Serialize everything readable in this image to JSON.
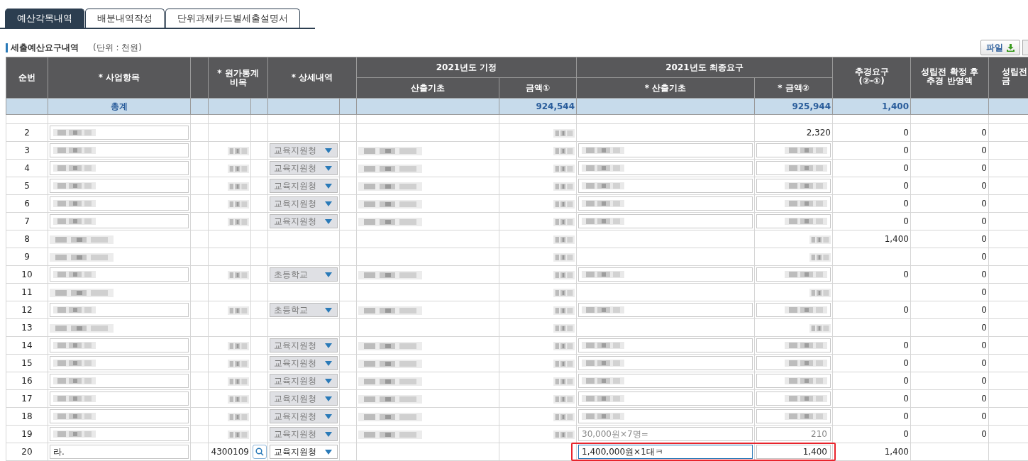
{
  "tabs": [
    {
      "label": "예산각목내역",
      "selected": true
    },
    {
      "label": "배분내역작성",
      "selected": false
    },
    {
      "label": "단위과제카드별세출설명서",
      "selected": false
    }
  ],
  "section": {
    "title": "세출예산요구내역",
    "unit": "(단위 : 천원)",
    "file_button": "파일"
  },
  "table": {
    "header_top": [
      "순번",
      "* 사업항목",
      "* 원가통계\n비목",
      "* 상세내역",
      "2021년도 기정",
      "2021년도 최종요구",
      "추경요구\n(②-①)",
      "성립전 확정 후\n추경 반영액",
      "성립전\n금"
    ],
    "header_sub": [
      "산출기초",
      "금액①",
      "* 산출기초",
      "* 금액②"
    ],
    "total": {
      "label": "총계",
      "plan_amount": "924,544",
      "final_amount": "925,944",
      "supplement": "1,400"
    },
    "rows": [
      {
        "no": "2",
        "item": {
          "field": true,
          "redacted": true
        },
        "plan_amount": {
          "redacted": true
        },
        "final_amount": {
          "text": "2,320"
        },
        "supplement": "0",
        "reflected": "0"
      },
      {
        "no": "3",
        "item": {
          "field": true,
          "redacted": true
        },
        "code": {
          "redacted": true
        },
        "detail": {
          "value": "교육지원청",
          "disabled": true
        },
        "plan_basis": {
          "redacted": true
        },
        "plan_amount": {
          "redacted": true
        },
        "final_basis": {
          "field": true,
          "redacted": true
        },
        "final_amount": {
          "field": true,
          "redacted": true
        },
        "supplement": "0",
        "reflected": "0"
      },
      {
        "no": "4",
        "item": {
          "field": true,
          "redacted": true
        },
        "code": {
          "redacted": true
        },
        "detail": {
          "value": "교육지원청",
          "disabled": true
        },
        "plan_basis": {
          "redacted": true
        },
        "plan_amount": {
          "redacted": true
        },
        "final_basis": {
          "field": true,
          "redacted": true
        },
        "final_amount": {
          "field": true,
          "redacted": true
        },
        "supplement": "0",
        "reflected": "0"
      },
      {
        "no": "5",
        "item": {
          "field": true,
          "redacted": true
        },
        "code": {
          "redacted": true
        },
        "detail": {
          "value": "교육지원청",
          "disabled": true
        },
        "plan_basis": {
          "redacted": true
        },
        "plan_amount": {
          "redacted": true
        },
        "final_basis": {
          "field": true,
          "redacted": true
        },
        "final_amount": {
          "field": true,
          "redacted": true
        },
        "supplement": "0",
        "reflected": "0"
      },
      {
        "no": "6",
        "item": {
          "field": true,
          "redacted": true
        },
        "code": {
          "redacted": true
        },
        "detail": {
          "value": "교육지원청",
          "disabled": true
        },
        "plan_basis": {
          "redacted": true
        },
        "plan_amount": {
          "redacted": true
        },
        "final_basis": {
          "field": true,
          "redacted": true
        },
        "final_amount": {
          "field": true,
          "redacted": true
        },
        "supplement": "0",
        "reflected": "0"
      },
      {
        "no": "7",
        "item": {
          "field": true,
          "redacted": true
        },
        "code": {
          "redacted": true
        },
        "detail": {
          "value": "교육지원청",
          "disabled": true
        },
        "plan_basis": {
          "redacted": true
        },
        "plan_amount": {
          "redacted": true
        },
        "final_basis": {
          "field": true,
          "redacted": true
        },
        "final_amount": {
          "field": true,
          "redacted": true
        },
        "supplement": "0",
        "reflected": "0"
      },
      {
        "no": "8",
        "item": {
          "redacted": true
        },
        "plan_amount": {
          "redacted": true
        },
        "final_amount": {
          "redacted": true
        },
        "supplement": "1,400",
        "reflected": "0"
      },
      {
        "no": "9",
        "item": {
          "redacted": true
        },
        "plan_amount": {
          "redacted": true
        },
        "final_amount": {
          "redacted": true
        },
        "reflected": "0"
      },
      {
        "no": "10",
        "item": {
          "field": true,
          "redacted": true
        },
        "code": {
          "redacted": true
        },
        "detail": {
          "value": "초등학교",
          "disabled": true
        },
        "plan_basis": {
          "redacted": true
        },
        "plan_amount": {
          "redacted": true
        },
        "final_basis": {
          "field": true,
          "redacted": true
        },
        "final_amount": {
          "field": true,
          "redacted": true
        },
        "supplement": "0",
        "reflected": "0"
      },
      {
        "no": "11",
        "item": {
          "redacted": true
        },
        "plan_amount": {
          "redacted": true
        },
        "final_amount": {
          "redacted": true
        },
        "reflected": "0"
      },
      {
        "no": "12",
        "item": {
          "field": true,
          "redacted": true
        },
        "code": {
          "redacted": true
        },
        "detail": {
          "value": "초등학교",
          "disabled": true
        },
        "plan_basis": {
          "redacted": true
        },
        "plan_amount": {
          "redacted": true
        },
        "final_basis": {
          "field": true,
          "redacted": true
        },
        "final_amount": {
          "field": true,
          "redacted": true
        },
        "supplement": "0",
        "reflected": "0"
      },
      {
        "no": "13",
        "item": {
          "redacted": true
        },
        "plan_amount": {
          "redacted": true
        },
        "final_amount": {
          "redacted": true
        },
        "reflected": "0"
      },
      {
        "no": "14",
        "item": {
          "field": true,
          "redacted": true
        },
        "code": {
          "redacted": true
        },
        "detail": {
          "value": "교육지원청",
          "disabled": true
        },
        "plan_basis": {
          "redacted": true
        },
        "plan_amount": {
          "redacted": true
        },
        "final_basis": {
          "field": true,
          "redacted": true
        },
        "final_amount": {
          "field": true,
          "redacted": true
        },
        "supplement": "0",
        "reflected": "0"
      },
      {
        "no": "15",
        "item": {
          "field": true,
          "redacted": true
        },
        "code": {
          "redacted": true
        },
        "detail": {
          "value": "교육지원청",
          "disabled": true
        },
        "plan_basis": {
          "redacted": true
        },
        "plan_amount": {
          "redacted": true
        },
        "final_basis": {
          "field": true,
          "redacted": true
        },
        "final_amount": {
          "field": true,
          "redacted": true
        },
        "supplement": "0",
        "reflected": "0"
      },
      {
        "no": "16",
        "item": {
          "field": true,
          "redacted": true
        },
        "code": {
          "redacted": true
        },
        "detail": {
          "value": "교육지원청",
          "disabled": true
        },
        "plan_basis": {
          "redacted": true
        },
        "plan_amount": {
          "redacted": true
        },
        "final_basis": {
          "field": true,
          "redacted": true
        },
        "final_amount": {
          "field": true,
          "redacted": true
        },
        "supplement": "0",
        "reflected": "0"
      },
      {
        "no": "17",
        "item": {
          "field": true,
          "redacted": true
        },
        "code": {
          "redacted": true
        },
        "detail": {
          "value": "교육지원청",
          "disabled": true
        },
        "plan_basis": {
          "redacted": true
        },
        "plan_amount": {
          "redacted": true
        },
        "final_basis": {
          "field": true,
          "redacted": true
        },
        "final_amount": {
          "field": true,
          "redacted": true
        },
        "supplement": "0",
        "reflected": "0"
      },
      {
        "no": "18",
        "item": {
          "field": true,
          "redacted": true
        },
        "code": {
          "redacted": true
        },
        "detail": {
          "value": "교육지원청",
          "disabled": true
        },
        "plan_basis": {
          "redacted": true
        },
        "plan_amount": {
          "redacted": true
        },
        "final_basis": {
          "field": true,
          "redacted": true
        },
        "final_amount": {
          "field": true,
          "redacted": true
        },
        "supplement": "0",
        "reflected": "0"
      },
      {
        "no": "19",
        "item": {
          "field": true,
          "redacted": true
        },
        "code": {
          "redacted": true
        },
        "detail": {
          "value": "교육지원청",
          "disabled": true
        },
        "plan_basis": {
          "redacted": true
        },
        "plan_amount": {
          "redacted": true
        },
        "final_basis": {
          "field": true,
          "text": "30,000원×7명=",
          "disabled": true
        },
        "final_amount": {
          "field": true,
          "text": "210",
          "disabled": true
        },
        "supplement": "0",
        "reflected": "0"
      },
      {
        "no": "20",
        "item": {
          "field": true,
          "text": "라."
        },
        "code": {
          "text": "4300109"
        },
        "search_button": true,
        "detail": {
          "value": "교육지원청",
          "disabled": false
        },
        "final_basis": {
          "field": true,
          "text": "1,400,000원×1대ㅋ",
          "focused": true
        },
        "final_amount": {
          "field": true,
          "text": "1,400"
        },
        "supplement": "1,400",
        "highlighted": true
      }
    ]
  }
}
